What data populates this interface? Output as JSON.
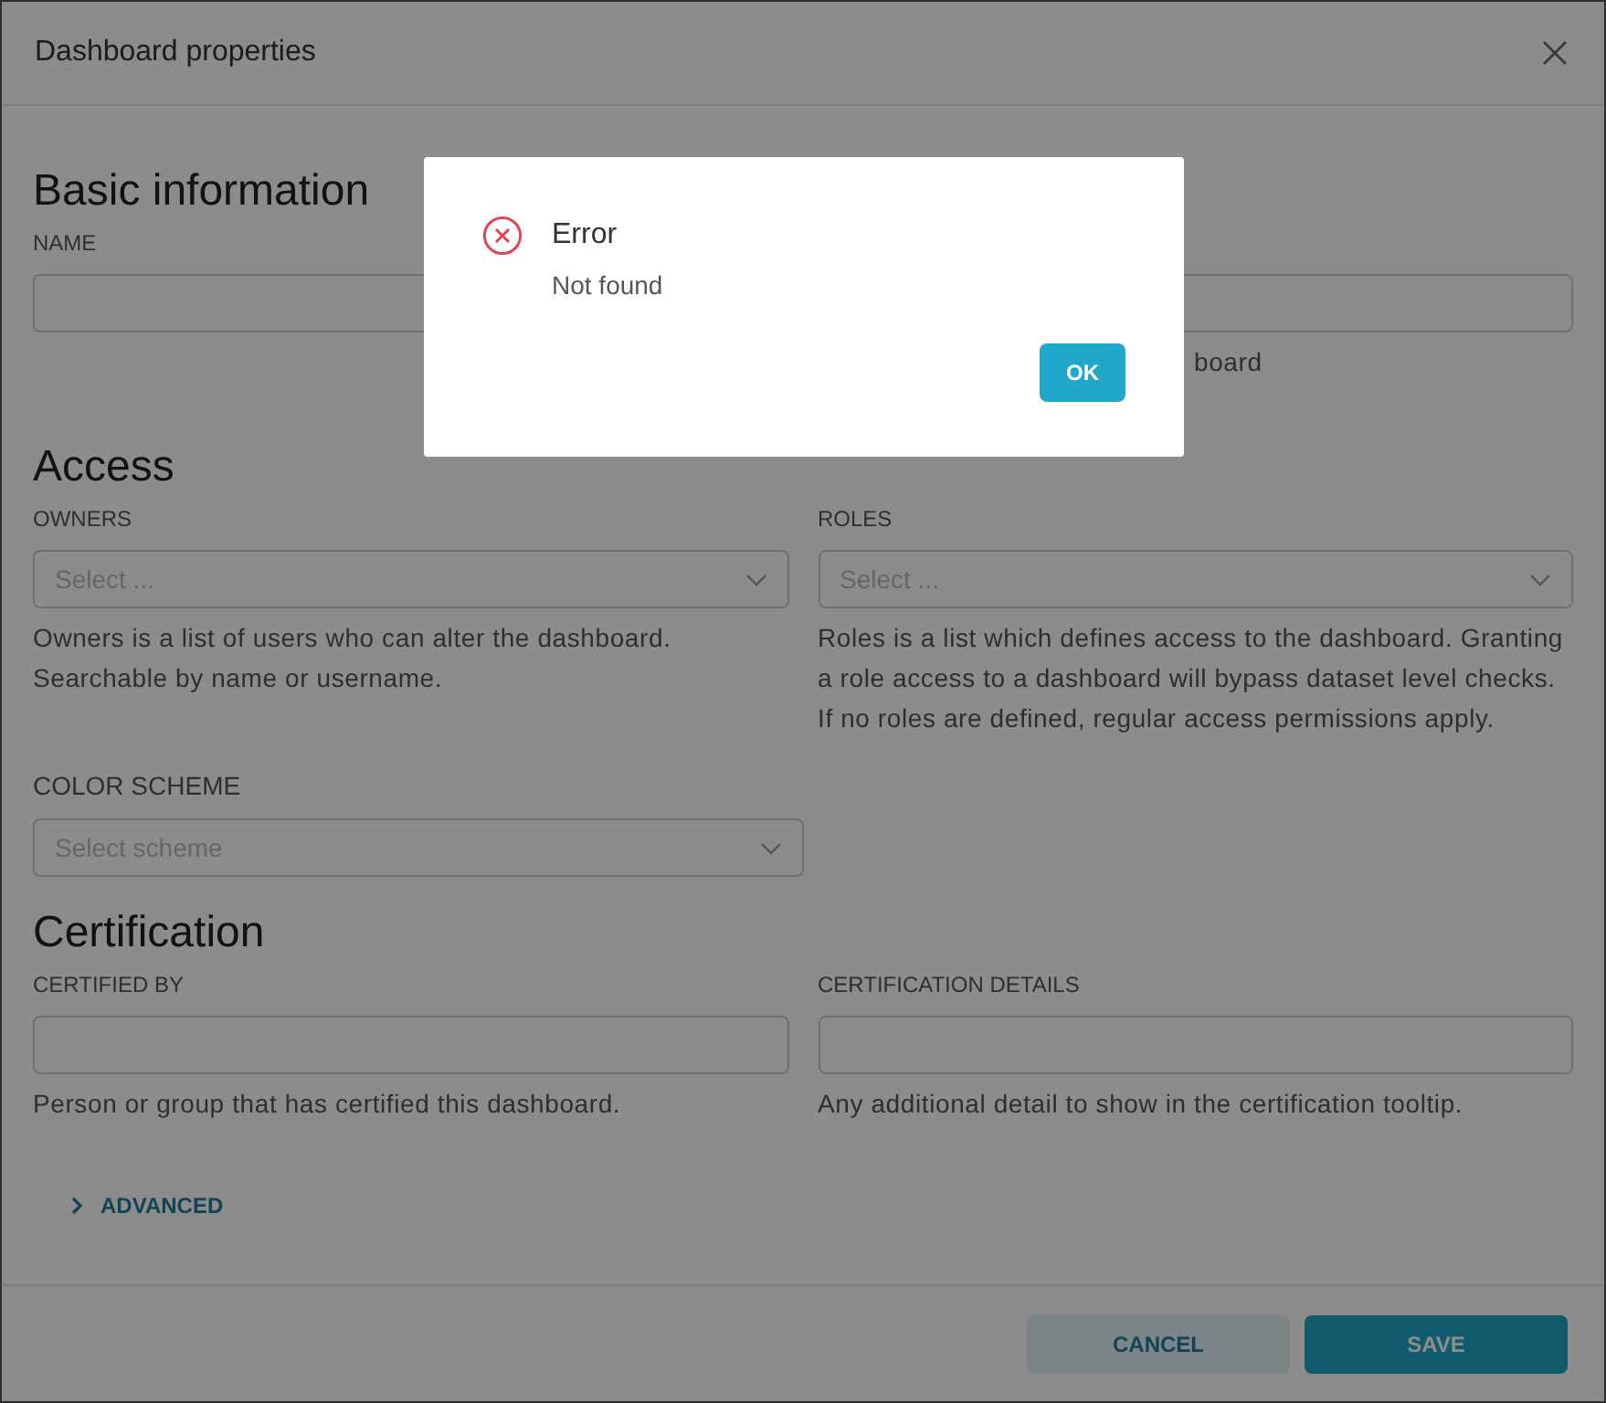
{
  "modal": {
    "title": "Dashboard properties"
  },
  "sections": [
    {
      "title": "Basic information",
      "rows": [
        [
          {
            "kind": "input",
            "label": "NAME"
          },
          {
            "kind": "input",
            "helper": "board",
            "partly_hidden": true
          }
        ]
      ]
    },
    {
      "title": "Access",
      "rows": [
        [
          {
            "kind": "select",
            "label": "OWNERS",
            "placeholder": "Select ...",
            "helper": "Owners is a list of users who can alter the dashboard. Searchable by name or username."
          },
          {
            "kind": "select",
            "label": "ROLES",
            "placeholder": "Select ...",
            "helper": "Roles is a list which defines access to the dashboard. Granting a role access to a dashboard will bypass dataset level checks. If no roles are defined, regular access permissions apply."
          }
        ],
        [
          {
            "kind": "scheme-select",
            "label": "COLOR SCHEME",
            "placeholder": "Select scheme"
          }
        ]
      ]
    },
    {
      "title": "Certification",
      "rows": [
        [
          {
            "kind": "input",
            "label": "CERTIFIED BY",
            "helper": "Person or group that has certified this dashboard."
          },
          {
            "kind": "input",
            "label": "CERTIFICATION DETAILS",
            "helper": "Any additional detail to show in the certification tooltip."
          }
        ]
      ]
    }
  ],
  "advanced": {
    "label": "ADVANCED",
    "expanded": false
  },
  "buttons": [
    {
      "label": "CANCEL",
      "kind": "secondary"
    },
    {
      "label": "SAVE",
      "kind": "primary"
    }
  ],
  "dialog": {
    "title": "Error",
    "message": "Not found",
    "button": "OK"
  }
}
